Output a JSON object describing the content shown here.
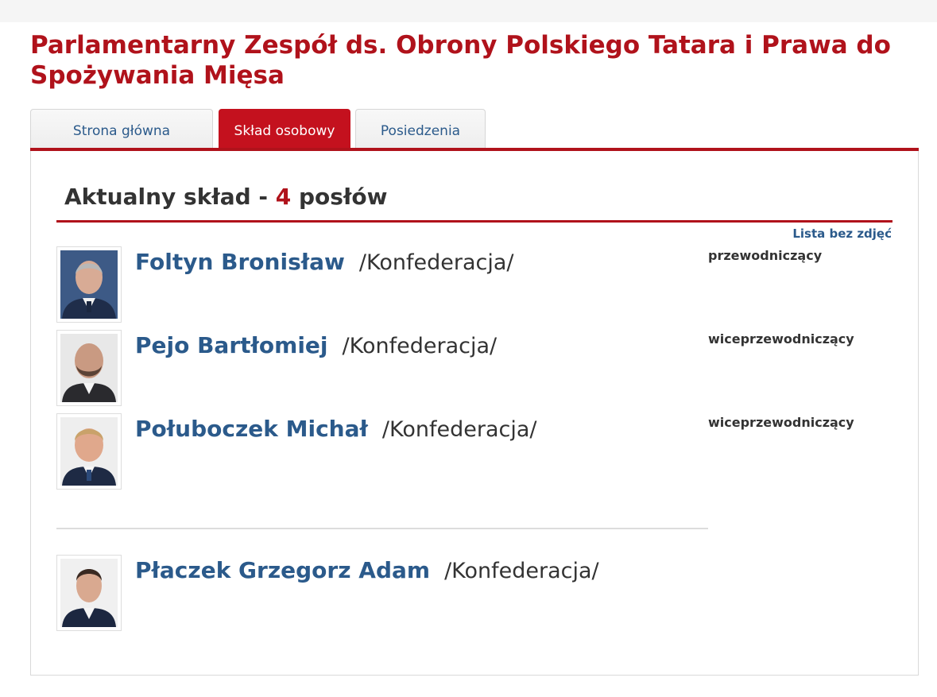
{
  "page": {
    "title": "Parlamentarny Zespół ds. Obrony Polskiego Tatara i Prawa do Spożywania Mięsa"
  },
  "tabs": [
    {
      "label": "Strona główna",
      "active": false
    },
    {
      "label": "Skład osobowy",
      "active": true
    },
    {
      "label": "Posiedzenia",
      "active": false
    }
  ],
  "section": {
    "heading_prefix": "Aktualny skład -",
    "count": "4",
    "heading_suffix": "posłów",
    "list_link": "Lista bez zdjęć"
  },
  "members": [
    {
      "name": "Foltyn Bronisław",
      "party": "/Konfederacja/",
      "role": "przewodniczący"
    },
    {
      "name": "Pejo Bartłomiej",
      "party": "/Konfederacja/",
      "role": "wiceprzewodniczący"
    },
    {
      "name": "Połuboczek Michał",
      "party": "/Konfederacja/",
      "role": "wiceprzewodniczący"
    },
    {
      "name": "Płaczek Grzegorz Adam",
      "party": "/Konfederacja/",
      "role": ""
    }
  ],
  "colors": {
    "accent": "#b0121b",
    "link": "#2b5a8b",
    "text": "#333333"
  }
}
